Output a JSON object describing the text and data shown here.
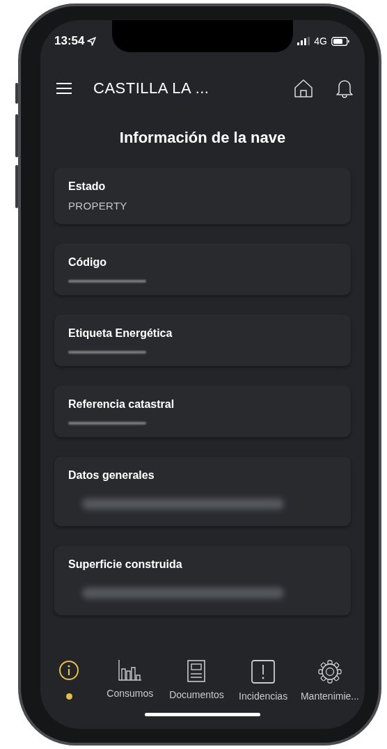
{
  "status_bar": {
    "time": "13:54",
    "network": "4G"
  },
  "header": {
    "title": "CASTILLA LA ..."
  },
  "page_title": "Información de la nave",
  "cards": [
    {
      "label": "Estado",
      "kind": "text",
      "value": "PROPERTY"
    },
    {
      "label": "Código",
      "kind": "redacted"
    },
    {
      "label": "Etiqueta Energética",
      "kind": "redacted"
    },
    {
      "label": "Referencia catastral",
      "kind": "redacted"
    },
    {
      "label": "Datos generales",
      "kind": "redacted_wide"
    },
    {
      "label": "Superficie construida",
      "kind": "redacted_wide"
    }
  ],
  "bottom_nav": [
    {
      "kind": "info",
      "selected": true
    },
    {
      "kind": "chart",
      "label": "Consumos",
      "selected": false
    },
    {
      "kind": "document",
      "label": "Documentos",
      "selected": false
    },
    {
      "kind": "alert",
      "label": "Incidencias",
      "selected": false
    },
    {
      "kind": "gear",
      "label": "Mantenimie...",
      "selected": false
    }
  ]
}
